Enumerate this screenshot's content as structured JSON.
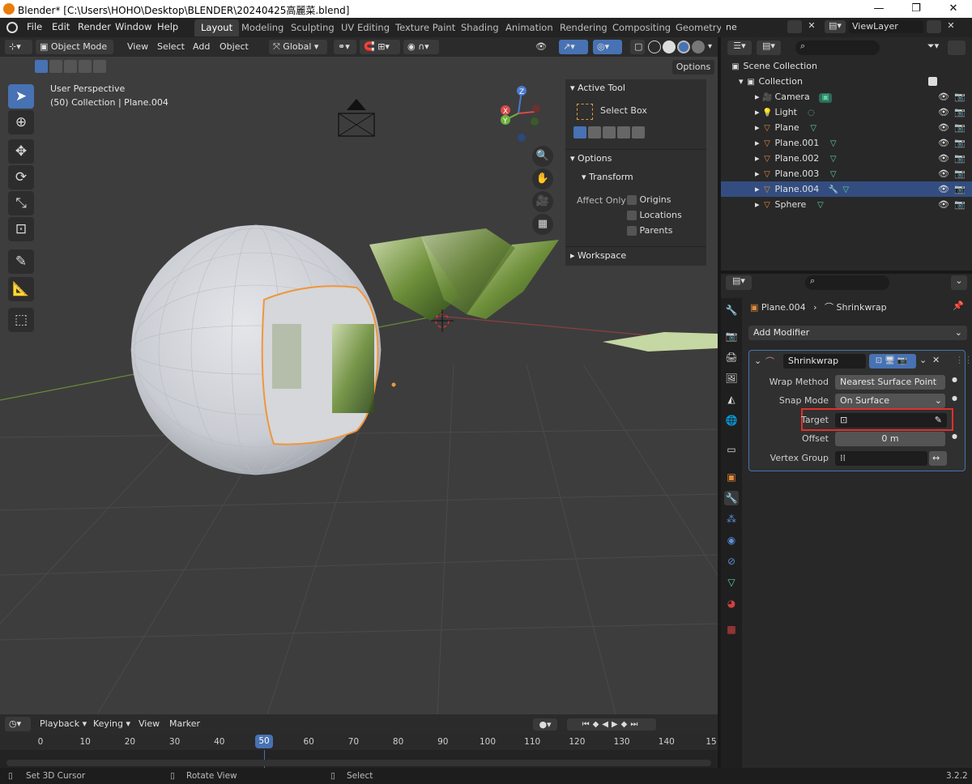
{
  "titlebar": {
    "title": "Blender* [C:\\Users\\HOHO\\Desktop\\BLENDER\\20240425高麗菜.blend]",
    "minimize": "—",
    "maximize": "❐",
    "close": "✕"
  },
  "menu": [
    "File",
    "Edit",
    "Render",
    "Window",
    "Help"
  ],
  "workspace_tabs": [
    "Layout",
    "Modeling",
    "Sculpting",
    "UV Editing",
    "Texture Paint",
    "Shading",
    "Animation",
    "Rendering",
    "Compositing",
    "Geometry"
  ],
  "viewport_header": {
    "mode": "Object Mode",
    "menus": [
      "View",
      "Select",
      "Add",
      "Object"
    ],
    "orientation": "Global",
    "options_label": "Options"
  },
  "viewport": {
    "perspective": "User Perspective",
    "collection_info": "(50) Collection | Plane.004",
    "gizmo_axes": [
      "Z",
      "X",
      "Y"
    ]
  },
  "n_panel": {
    "active_tool_label": "Active Tool",
    "tool_name": "Select Box",
    "options_label": "Options",
    "transform_label": "Transform",
    "affect_only_label": "Affect Only",
    "affect_options": [
      "Origins",
      "Locations",
      "Parents"
    ],
    "workspace_label": "Workspace"
  },
  "timeline": {
    "menus": [
      "Playback",
      "Keying",
      "View",
      "Marker"
    ],
    "current_frame": "50",
    "ticks": [
      "0",
      "10",
      "20",
      "30",
      "40",
      "50",
      "60",
      "70",
      "80",
      "90",
      "100",
      "110",
      "120",
      "130",
      "140",
      "15"
    ]
  },
  "statusbar": {
    "items": [
      "Set 3D Cursor",
      "Rotate View",
      "Select"
    ],
    "version": "3.2.2"
  },
  "outliner": {
    "header_fragment": "ne",
    "viewlayer": "ViewLayer",
    "scene_collection": "Scene Collection",
    "collection": "Collection",
    "items": [
      {
        "name": "Camera",
        "type": "camera"
      },
      {
        "name": "Light",
        "type": "light"
      },
      {
        "name": "Plane",
        "type": "mesh"
      },
      {
        "name": "Plane.001",
        "type": "mesh"
      },
      {
        "name": "Plane.002",
        "type": "mesh"
      },
      {
        "name": "Plane.003",
        "type": "mesh"
      },
      {
        "name": "Plane.004",
        "type": "mesh",
        "selected": true
      },
      {
        "name": "Sphere",
        "type": "mesh"
      }
    ]
  },
  "properties": {
    "breadcrumb_object": "Plane.004",
    "breadcrumb_modifier": "Shrinkwrap",
    "add_modifier": "Add Modifier",
    "modifier_name": "Shrinkwrap",
    "fields": {
      "wrap_method_label": "Wrap Method",
      "wrap_method_value": "Nearest Surface Point",
      "snap_mode_label": "Snap Mode",
      "snap_mode_value": "On Surface",
      "target_label": "Target",
      "target_value": "",
      "offset_label": "Offset",
      "offset_value": "0 m",
      "vertex_group_label": "Vertex Group",
      "vertex_group_value": ""
    }
  },
  "colors": {
    "accent": "#4772b3",
    "highlight_box": "#e0302a",
    "selected_row": "#334d80",
    "mesh_icon": "#e38a3a",
    "data_icon": "#5dd39b"
  }
}
